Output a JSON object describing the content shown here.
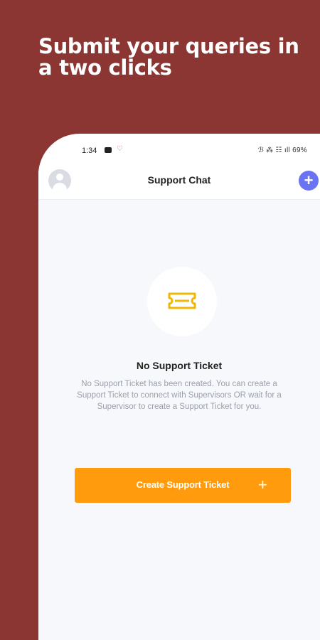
{
  "promo": {
    "headline": "Submit your queries in a two clicks"
  },
  "status_bar": {
    "time": "1:34",
    "right": "ℬ ⁂ ☷ ıll 69%"
  },
  "app_bar": {
    "title": "Support Chat",
    "add_symbol": "+"
  },
  "empty_state": {
    "title": "No Support Ticket",
    "description": "No Support Ticket has been created. You can create a Support Ticket to connect with Supervisors OR wait for a Supervisor to create a Support Ticket for you."
  },
  "create_button": {
    "label": "Create Support Ticket",
    "plus": "+"
  },
  "colors": {
    "background": "#8b3632",
    "accent_orange": "#ff9b0d",
    "accent_blue": "#6a74f3",
    "ticket_icon": "#f2b705"
  },
  "icons": {
    "avatar": "avatar-icon",
    "add": "plus-icon",
    "ticket": "ticket-icon"
  }
}
